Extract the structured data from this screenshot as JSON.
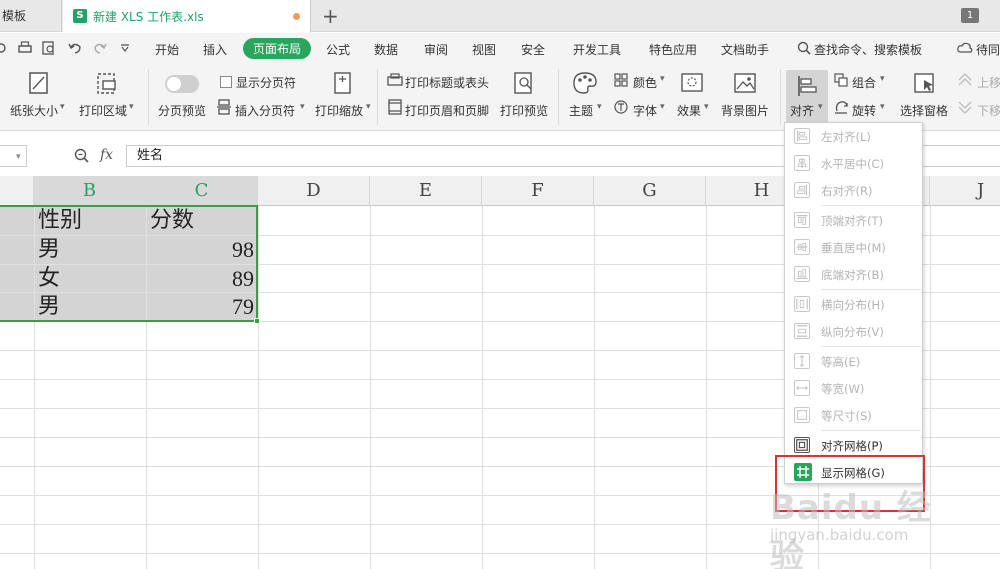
{
  "tabs": {
    "prev_tab": "模板",
    "active_tab": "新建 XLS 工作表.xls",
    "s_icon": "S",
    "add": "+",
    "window_count": "1"
  },
  "quick_access": {
    "undo_icon": "undo-icon",
    "redo_icon": "redo-icon"
  },
  "menu": {
    "items": [
      "开始",
      "插入",
      "页面布局",
      "公式",
      "数据",
      "审阅",
      "视图",
      "安全",
      "开发工具",
      "特色应用",
      "文档助手"
    ],
    "active": "页面布局",
    "search": "查找命令、搜索模板",
    "sync": "待同"
  },
  "ribbon": {
    "paper_size": "纸张大小",
    "print_area": "打印区域",
    "page_preview": "分页预览",
    "show_page_break": "显示分页符",
    "insert_page_break": "插入分页符",
    "print_scale": "打印缩放",
    "print_titles": "打印标题或表头",
    "print_header_footer": "打印页眉和页脚",
    "print_preview": "打印预览",
    "theme": "主题",
    "color": "颜色",
    "font": "字体",
    "effect": "效果",
    "bg_image": "背景图片",
    "align": "对齐",
    "group": "组合",
    "rotate": "旋转",
    "selection_pane": "选择窗格",
    "move_up": "上移",
    "move_down": "下移"
  },
  "formula_bar": {
    "fx": "fx",
    "content": "姓名"
  },
  "grid": {
    "columns": [
      "B",
      "C",
      "D",
      "E",
      "F",
      "G",
      "H",
      "J"
    ],
    "rows": [
      [
        "性别",
        "分数"
      ],
      [
        "男",
        "98"
      ],
      [
        "女",
        "89"
      ],
      [
        "男",
        "79"
      ]
    ]
  },
  "align_menu": {
    "items": [
      {
        "label": "左对齐(L)",
        "enabled": false
      },
      {
        "label": "水平居中(C)",
        "enabled": false
      },
      {
        "label": "右对齐(R)",
        "enabled": false
      },
      {
        "label": "顶端对齐(T)",
        "enabled": false
      },
      {
        "label": "垂直居中(M)",
        "enabled": false
      },
      {
        "label": "底端对齐(B)",
        "enabled": false
      },
      {
        "label": "横向分布(H)",
        "enabled": false
      },
      {
        "label": "纵向分布(V)",
        "enabled": false
      },
      {
        "label": "等高(E)",
        "enabled": false
      },
      {
        "label": "等宽(W)",
        "enabled": false
      },
      {
        "label": "等尺寸(S)",
        "enabled": false
      },
      {
        "label": "对齐网格(P)",
        "enabled": true
      },
      {
        "label": "显示网格(G)",
        "enabled": true,
        "checked": true
      }
    ]
  },
  "watermark": {
    "logo": "Baidu 经验",
    "url": "jingyan.baidu.com"
  },
  "colors": {
    "accent": "#2aa55c",
    "highlight_box": "#e03030",
    "selection_border": "#3f9a4b"
  }
}
